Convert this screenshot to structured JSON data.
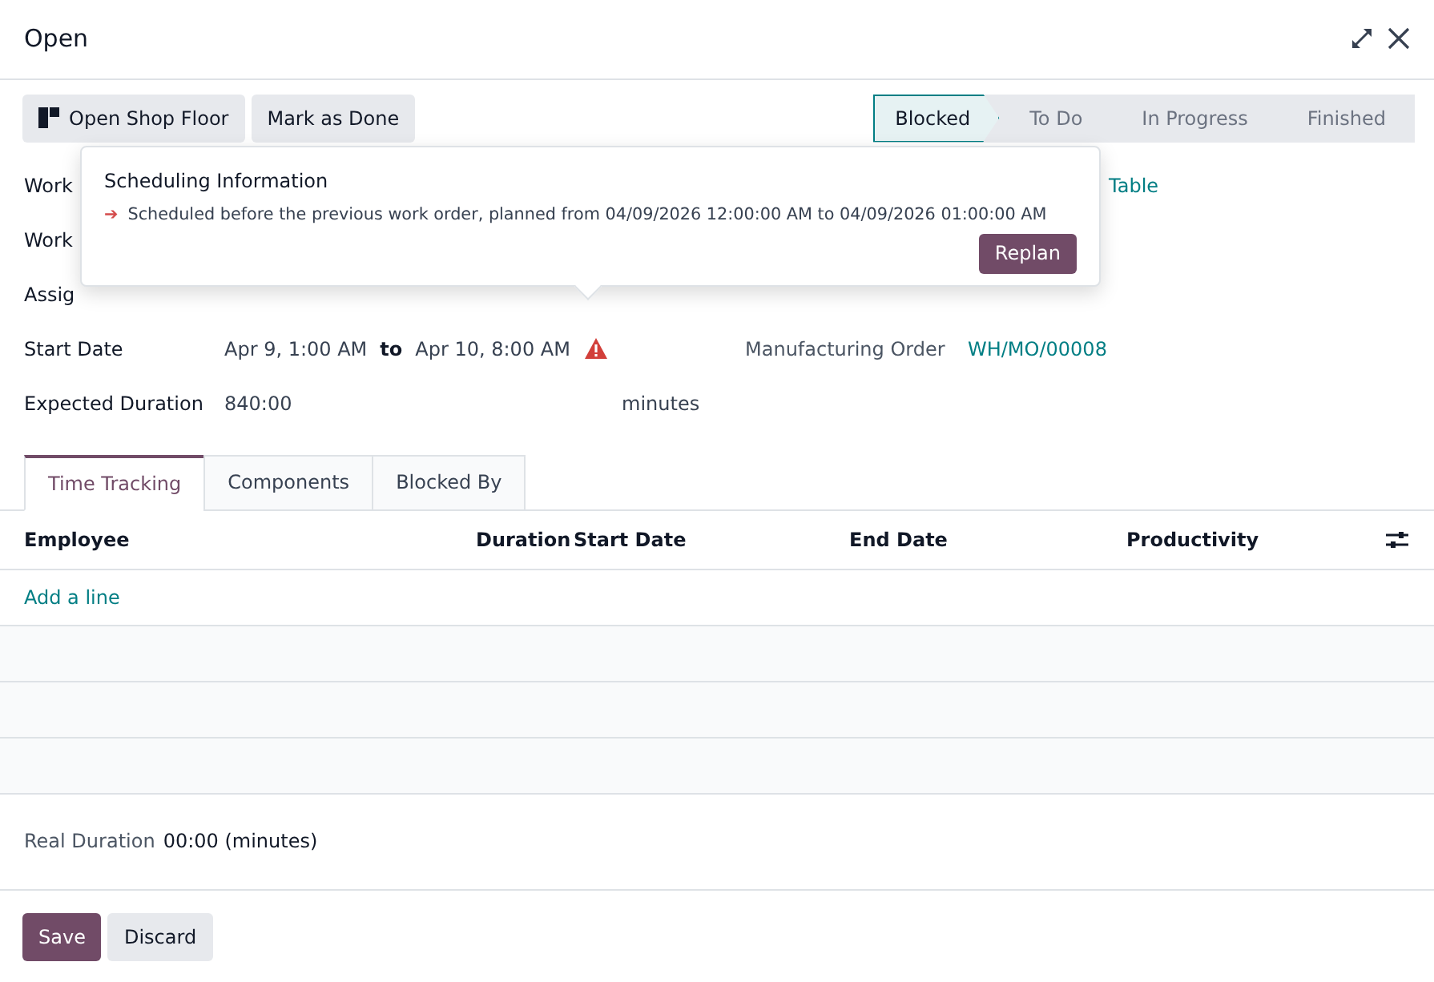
{
  "window": {
    "title": "Open"
  },
  "actions": [
    {
      "label": "Open Shop Floor",
      "kind": "icon"
    },
    {
      "label": "Mark as Done",
      "kind": "plain"
    }
  ],
  "statuses": [
    {
      "label": "Blocked",
      "selected": true
    },
    {
      "label": "To Do",
      "selected": false
    },
    {
      "label": "In Progress",
      "selected": false
    },
    {
      "label": "Finished",
      "selected": false
    }
  ],
  "covered_labels": [
    "Work",
    "Work",
    "Assig"
  ],
  "product_value": "Table",
  "start_date": {
    "label": "Start Date",
    "from": "Apr 9, 1:00 AM",
    "joiner": "to",
    "to": "Apr 10, 8:00 AM"
  },
  "manufacturing_order": {
    "label": "Manufacturing Order",
    "value": "WH/MO/00008"
  },
  "expected_duration": {
    "label": "Expected Duration",
    "value": "840:00",
    "unit": "minutes"
  },
  "popover": {
    "title": "Scheduling Information",
    "arrow": "➔",
    "message": "Scheduled before the previous work order, planned from 04/09/2026 12:00:00 AM to 04/09/2026 01:00:00 AM",
    "button": "Replan"
  },
  "tabs": [
    {
      "label": "Time Tracking",
      "selected": true
    },
    {
      "label": "Components",
      "selected": false
    },
    {
      "label": "Blocked By",
      "selected": false
    }
  ],
  "columns": [
    "Employee",
    "Duration",
    "Start Date",
    "End Date",
    "Productivity"
  ],
  "add_line": "Add a line",
  "real_duration": {
    "label": "Real Duration",
    "value": "00:00 (minutes)"
  },
  "footer": [
    {
      "label": "Save",
      "kind": "primary"
    },
    {
      "label": "Discard",
      "kind": "secondary"
    }
  ]
}
